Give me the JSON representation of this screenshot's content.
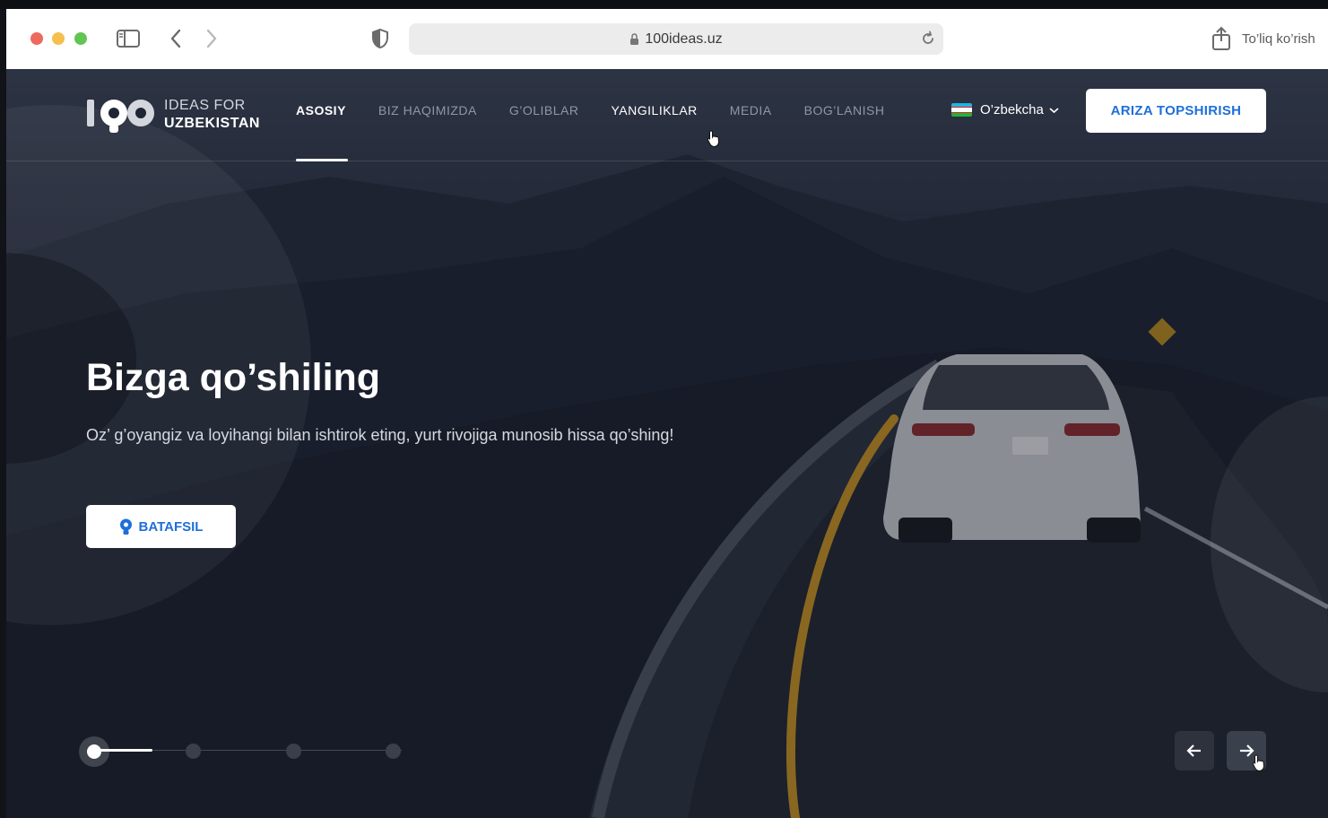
{
  "browser": {
    "url": "100ideas.uz",
    "fullscreen_label": "To’liq ko’rish"
  },
  "header": {
    "logo_line1": "IDEAS FOR",
    "logo_line2": "UZBEKISTAN",
    "logo_number": "100",
    "nav": [
      {
        "label": "ASOSIY",
        "state": "active"
      },
      {
        "label": "BIZ HAQIMIZDA",
        "state": "normal"
      },
      {
        "label": "G’OLIBLAR",
        "state": "normal"
      },
      {
        "label": "YANGILIKLAR",
        "state": "hover"
      },
      {
        "label": "MEDIA",
        "state": "normal"
      },
      {
        "label": "BOG’LANISH",
        "state": "normal"
      }
    ],
    "language": "O’zbekcha",
    "apply_button": "ARIZA TOPSHIRISH"
  },
  "hero": {
    "title": "Bizga qo’shiling",
    "subtitle": "Oz’ g’oyangiz va loyihangi bilan ishtirok eting, yurt rivojiga munosib hissa qo’shing!",
    "more_button": "BATAFSIL"
  },
  "slider": {
    "current_slide": 1,
    "total_slides": 4
  },
  "colors": {
    "accent": "#1e6fd9",
    "page_dark": "#1b2030"
  }
}
